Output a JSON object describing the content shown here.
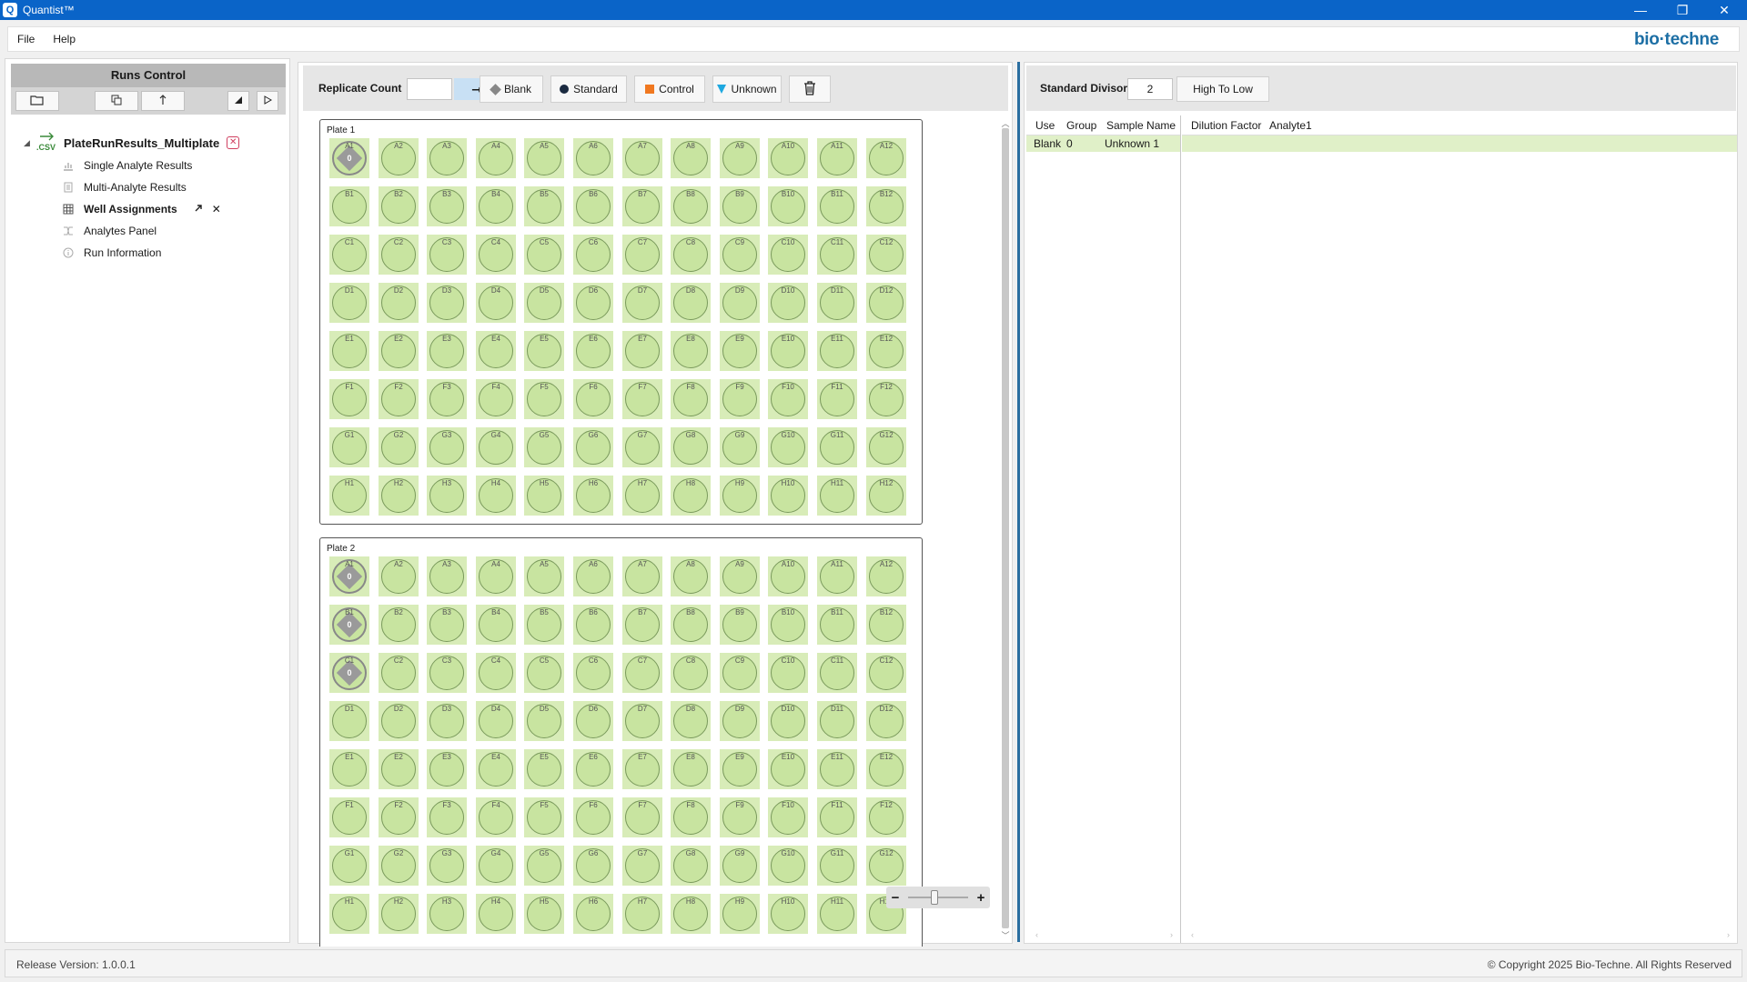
{
  "window": {
    "title": "Quantist™",
    "icon_letter": "Q",
    "minimize": "—",
    "restore": "❐",
    "close": "✕"
  },
  "menu": {
    "items": [
      "File",
      "Help"
    ],
    "brand": "bio·techne"
  },
  "left_panel": {
    "header": "Runs Control",
    "toolbar_icons": [
      "open-folder-icon",
      "copy-icon",
      "upload-icon",
      "triangle-icon",
      "play-icon"
    ],
    "tree": {
      "root_label": "PlateRunResults_Multiplate",
      "root_icon_text": ".CSV",
      "items": [
        {
          "label": "Single Analyte Results",
          "icon": "chart-icon"
        },
        {
          "label": "Multi-Analyte Results",
          "icon": "document-icon"
        },
        {
          "label": "Well Assignments",
          "icon": "grid-icon",
          "active": true
        },
        {
          "label": "Analytes Panel",
          "icon": "flow-icon"
        },
        {
          "label": "Run Information",
          "icon": "info-icon"
        }
      ]
    }
  },
  "center": {
    "replicate_label": "Replicate Count",
    "replicate_value": "",
    "apply_arrow": "➞",
    "type_buttons": [
      {
        "label": "Blank",
        "shape": "diamond"
      },
      {
        "label": "Standard",
        "shape": "circle"
      },
      {
        "label": "Control",
        "shape": "square"
      },
      {
        "label": "Unknown",
        "shape": "triangle"
      }
    ],
    "clear_icon": "trash-icon",
    "rows": [
      "A",
      "B",
      "C",
      "D",
      "E",
      "F",
      "G",
      "H"
    ],
    "cols": 12,
    "plates": [
      {
        "label": "Plate 1",
        "blanks": [
          {
            "well": "A1",
            "value": "0"
          }
        ]
      },
      {
        "label": "Plate 2",
        "blanks": [
          {
            "well": "A1",
            "value": "0"
          },
          {
            "well": "B1",
            "value": "0"
          },
          {
            "well": "C1",
            "value": "0"
          }
        ]
      }
    ],
    "zoom": {
      "minus": "−",
      "plus": "+",
      "level": 0.4
    }
  },
  "right": {
    "std_divisor_label": "Standard Divisor",
    "std_divisor_value": "2",
    "sort_button": "High To Low",
    "left_headers": [
      "Use",
      "Group",
      "Sample Name"
    ],
    "right_headers": [
      "Dilution Factor",
      "Analyte1"
    ],
    "rows": [
      {
        "use": "Blank",
        "group": "0",
        "sample_name": "Unknown 1",
        "dilution_factor": "",
        "analyte1": ""
      }
    ]
  },
  "status": {
    "version": "Release Version: 1.0.0.1",
    "copyright": "© Copyright 2025 Bio-Techne. All Rights Reserved"
  }
}
